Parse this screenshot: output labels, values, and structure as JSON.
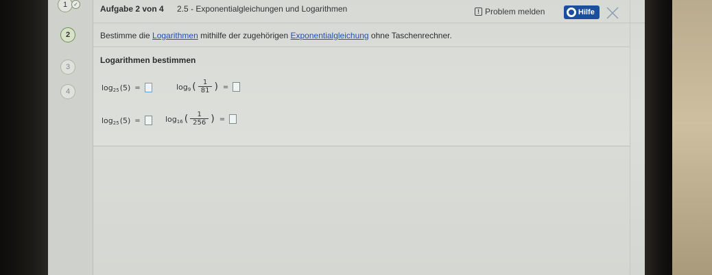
{
  "header": {
    "task_counter": "Aufgabe 2 von 4",
    "section_title": "2.5 - Exponentialgleichungen und Logarithmen",
    "report_label": "Problem melden",
    "help_label": "Hilfe"
  },
  "steps": [
    {
      "label": "1"
    },
    {
      "label": "2"
    },
    {
      "label": "3"
    },
    {
      "label": "4"
    }
  ],
  "instruction": {
    "part1": "Bestimme die ",
    "link1": "Logarithmen",
    "part2": " mithilfe der zugehörigen ",
    "link2": "Exponentialgleichung",
    "part3": " ohne Taschenrechner."
  },
  "exercise": {
    "title": "Logarithmen bestimmen",
    "eq1": {
      "base": "25",
      "arg": "(5)",
      "eq": "="
    },
    "eq2": {
      "base": "9",
      "num": "1",
      "den": "81",
      "eq": "="
    },
    "eq3": {
      "base": "25",
      "arg": "(5)",
      "eq": "="
    },
    "eq4": {
      "base": "16",
      "num": "1",
      "den": "256",
      "eq": "="
    },
    "log": "log"
  },
  "colors": {
    "help_button": "#1a4fa0",
    "link": "#1f4fb5",
    "answer_box_border": "#5aa2d6"
  }
}
